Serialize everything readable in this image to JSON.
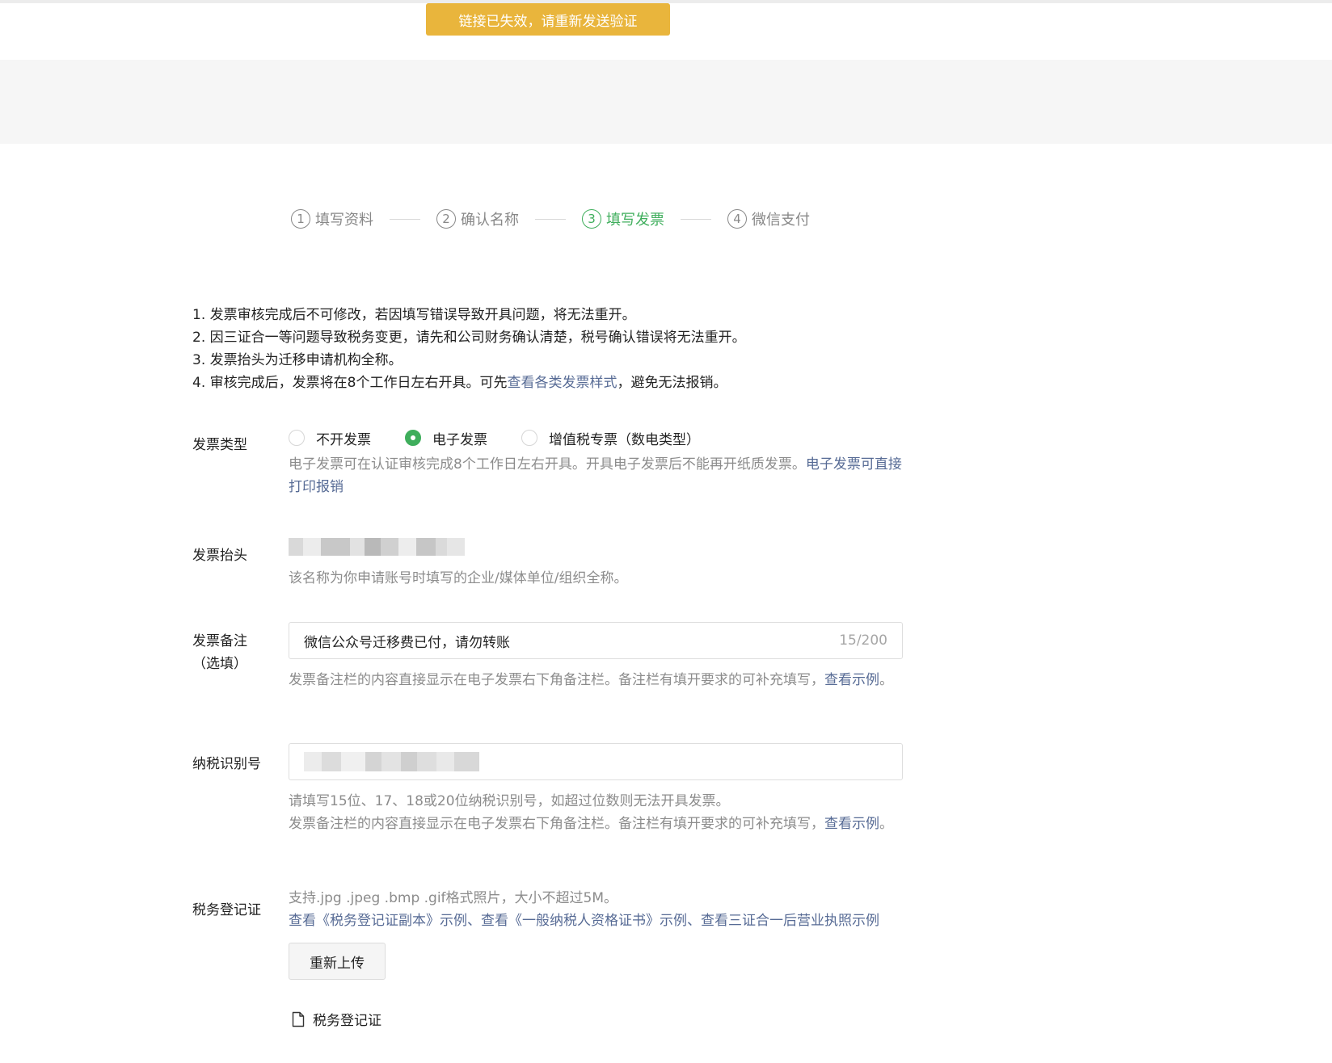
{
  "toast": {
    "text": "链接已失效，请重新发送验证"
  },
  "steps": [
    {
      "num": "1",
      "label": "填写资料"
    },
    {
      "num": "2",
      "label": "确认名称"
    },
    {
      "num": "3",
      "label": "填写发票"
    },
    {
      "num": "4",
      "label": "微信支付"
    }
  ],
  "active_step": 3,
  "notes": {
    "line1": "1. 发票审核完成后不可修改，若因填写错误导致开具问题，将无法重开。",
    "line2": "2. 因三证合一等问题导致税务变更，请先和公司财务确认清楚，税号确认错误将无法重开。",
    "line3": "3. 发票抬头为迁移申请机构全称。",
    "line4_prefix": "4. 审核完成后，发票将在8个工作日左右开具。可先",
    "line4_link": "查看各类发票样式",
    "line4_suffix": "，避免无法报销。"
  },
  "invoice_type": {
    "label": "发票类型",
    "options": [
      "不开发票",
      "电子发票",
      "增值税专票（数电类型）"
    ],
    "selected": "电子发票",
    "hint_text": "电子发票可在认证审核完成8个工作日左右开具。开具电子发票后不能再开纸质发票。",
    "hint_link": "电子发票可直接打印报销"
  },
  "invoice_title": {
    "label": "发票抬头",
    "hint": "该名称为你申请账号时填写的企业/媒体单位/组织全称。"
  },
  "invoice_remark": {
    "label_line1": "发票备注",
    "label_line2": "（选填）",
    "value": "微信公众号迁移费已付，请勿转账",
    "counter": "15/200",
    "hint_text": "发票备注栏的内容直接显示在电子发票右下角备注栏。备注栏有填开要求的可补充填写，",
    "hint_link": "查看示例",
    "hint_end": "。"
  },
  "tax_id": {
    "label": "纳税识别号",
    "hint_line1": "请填写15位、17、18或20位纳税识别号，如超过位数则无法开具发票。",
    "hint_text": "发票备注栏的内容直接显示在电子发票右下角备注栏。备注栏有填开要求的可补充填写，",
    "hint_link": "查看示例",
    "hint_end": "。"
  },
  "tax_cert": {
    "label": "税务登记证",
    "hint_line1": "支持.jpg .jpeg .bmp .gif格式照片，大小不超过5M。",
    "link1": "查看《税务登记证副本》示例",
    "sep1": "、",
    "link2": "查看《一般纳税人资格证书》示例",
    "sep2": "、",
    "link3": "查看三证合一后营业执照示例",
    "upload_button": "重新上传",
    "file_name": "税务登记证"
  },
  "colors": {
    "accent_green": "#3fae5c",
    "toast_yellow": "#e9b53c",
    "link_blue": "#576b95"
  }
}
